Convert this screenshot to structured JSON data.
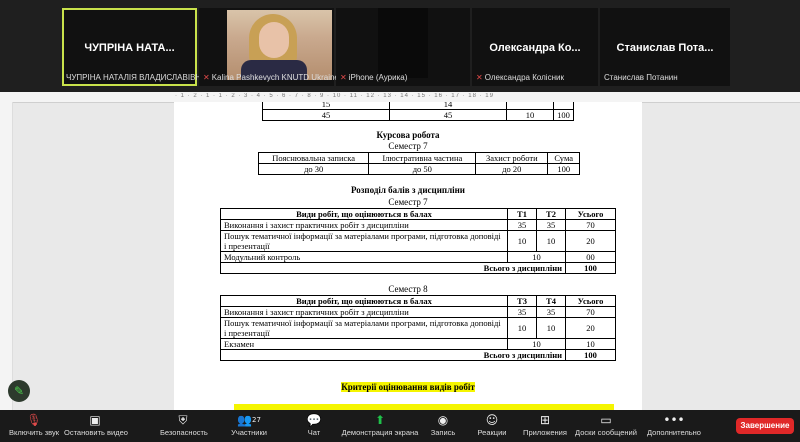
{
  "participants": [
    {
      "big": "ЧУПРІНА НАТА...",
      "name": "ЧУПРІНА НАТАЛІЯ ВЛАДИСЛАВІВНА",
      "muted": false
    },
    {
      "big": "",
      "name": "Kalina Pashkevych KNUTD Ukraine",
      "muted": true
    },
    {
      "big": "",
      "name": "iPhone (Аурика)",
      "muted": true
    },
    {
      "big": "Олександра Ко...",
      "name": "Олександра Колісник",
      "muted": true
    },
    {
      "big": "Станислав Пота...",
      "name": "Станислав Потанин",
      "muted": false
    }
  ],
  "ruler": "· 1 · 2 · 1 · 1 · 2 · 3 · 4 · 5 · 6 · 7 · 8 · 9 · 10 · 11 · 12 · 13 · 14 · 15 · 16 · 17 · 18 · 19",
  "doc": {
    "top_table": {
      "row1": [
        "15",
        "14",
        "",
        ""
      ],
      "row2": [
        "45",
        "45",
        "10",
        "100"
      ]
    },
    "coursework_title": "Курсова робота",
    "coursework_semester": "Семестр 7",
    "coursework_headers": [
      "Пояснювальна записка",
      "Ілюстративна частина",
      "Захист роботи",
      "Сума"
    ],
    "coursework_values": [
      "до 30",
      "до 50",
      "до 20",
      "100"
    ],
    "distribution_title": "Розподіл балів з дисципліни",
    "sem7_label": "Семестр 7",
    "sem7": {
      "headers": [
        "Види робіт, що оцінюються в балах",
        "T1",
        "T2",
        "Усього"
      ],
      "rows": [
        [
          "Виконання і захист практичних робіт з  дисципліни",
          "35",
          "35",
          "70"
        ],
        [
          "Пошук тематичної інформації за матеріалами програми, підготовка доповіді і презентації",
          "10",
          "10",
          "20"
        ],
        [
          "Модульний контроль",
          "10",
          "",
          "00"
        ]
      ],
      "total_label": "Всього з дисципліни",
      "total": "100"
    },
    "sem8_label": "Семестр 8",
    "sem8": {
      "headers": [
        "Види робіт, що оцінюються в балах",
        "T3",
        "T4",
        "Усього"
      ],
      "rows": [
        [
          "Виконання і захист практичних робіт з  дисципліни",
          "35",
          "35",
          "70"
        ],
        [
          "Пошук тематичної інформації за матеріалами програми, підготовка доповіді і презентації",
          "10",
          "10",
          "20"
        ],
        [
          "Екзамен",
          "10",
          "",
          "10"
        ]
      ],
      "total_label": "Всього з дисципліни",
      "total": "100"
    },
    "criteria_title": "Критерії оцінювання видів робіт"
  },
  "toolbar": {
    "mute": "Включить звук",
    "video": "Остановить видео",
    "security": "Безопасность",
    "participants": "Участники",
    "participants_count": "27",
    "chat": "Чат",
    "share": "Демонстрация экрана",
    "record": "Запись",
    "reactions": "Реакции",
    "apps": "Приложения",
    "whiteboard": "Доски сообщений",
    "more": "Дополнительно",
    "end": "Завершение"
  },
  "colors": {
    "share_green": "#1ea84a",
    "end_red": "#e02828",
    "highlight": "#f5f500"
  }
}
